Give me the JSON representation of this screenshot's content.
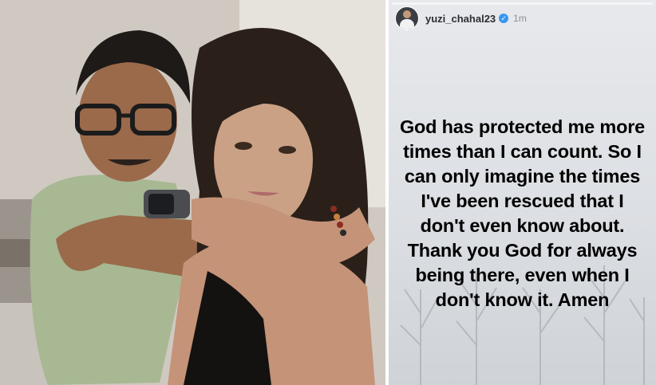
{
  "story": {
    "username": "yuzi_chahal23",
    "time": "1m",
    "text": "God has protected me more times than I can count. So I can only imagine the times I've been rescued that I don't even know about. Thank you God for always being there, even when I don't know it. Amen",
    "icons": {
      "verified": "verified-badge-icon",
      "avatar": "profile-avatar"
    }
  },
  "colors": {
    "verified": "#3897f0",
    "text": "#000000"
  }
}
